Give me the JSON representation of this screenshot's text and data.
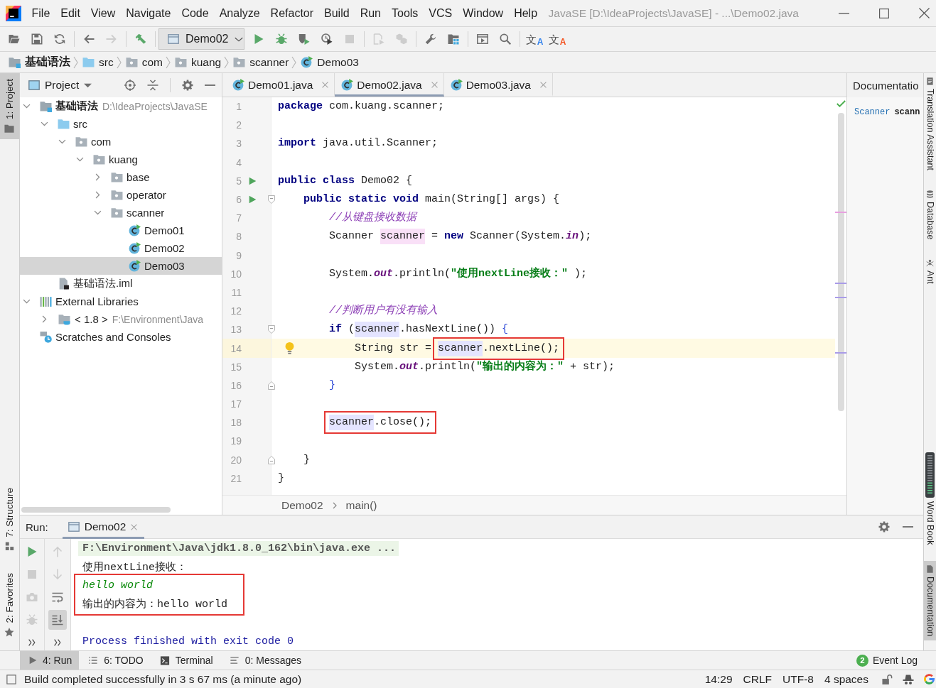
{
  "window": {
    "title": "JavaSE [D:\\IdeaProjects\\JavaSE] - ...\\Demo02.java"
  },
  "menu": [
    "File",
    "Edit",
    "View",
    "Navigate",
    "Code",
    "Analyze",
    "Refactor",
    "Build",
    "Run",
    "Tools",
    "VCS",
    "Window",
    "Help"
  ],
  "toolbar": {
    "groups": [
      [
        {
          "kind": "open",
          "disabled": false
        },
        {
          "kind": "save",
          "disabled": false
        },
        {
          "kind": "sync",
          "disabled": false
        }
      ],
      [
        {
          "kind": "back",
          "disabled": false
        },
        {
          "kind": "forward",
          "disabled": true
        }
      ],
      [
        {
          "kind": "build",
          "disabled": false
        }
      ],
      [
        {
          "kind": "run_config",
          "label": "Demo02",
          "disabled": false
        },
        {
          "kind": "run",
          "disabled": false
        },
        {
          "kind": "debug",
          "disabled": false
        },
        {
          "kind": "coverage",
          "disabled": false
        },
        {
          "kind": "profile",
          "disabled": false
        },
        {
          "kind": "stop",
          "disabled": true
        }
      ],
      [
        {
          "kind": "attach",
          "disabled": true
        },
        {
          "kind": "packages",
          "disabled": true
        }
      ],
      [
        {
          "kind": "settings",
          "disabled": false
        },
        {
          "kind": "structure",
          "disabled": false
        }
      ],
      [
        {
          "kind": "frame",
          "disabled": false
        },
        {
          "kind": "search",
          "disabled": false
        }
      ],
      [
        {
          "kind": "translate",
          "glyph": "文",
          "letter": "A",
          "color": "#2f80ed",
          "disabled": false
        },
        {
          "kind": "translate",
          "glyph": "文",
          "letter": "A",
          "color": "#f4511e",
          "disabled": false
        }
      ]
    ]
  },
  "navigation_bar": [
    {
      "kind": "module",
      "label": "基础语法"
    },
    {
      "kind": "source",
      "label": "src"
    },
    {
      "kind": "package",
      "label": "com"
    },
    {
      "kind": "package",
      "label": "kuang"
    },
    {
      "kind": "package",
      "label": "scanner"
    },
    {
      "kind": "class",
      "label": "Demo03"
    }
  ],
  "left_stripe": {
    "top": [
      {
        "kind": "project",
        "label": "1: Project",
        "selected": true
      }
    ],
    "bottom": [
      {
        "kind": "structure",
        "label": "7: Structure",
        "selected": false
      },
      {
        "kind": "favorites",
        "label": "2: Favorites",
        "selected": false
      }
    ]
  },
  "project": {
    "title": "Project",
    "tree": [
      {
        "kind": "module",
        "label": "基础语法",
        "hint": "D:\\IdeaProjects\\JavaSE",
        "expanded": true,
        "selected": false,
        "children": [
          {
            "kind": "source",
            "label": "src",
            "expanded": true,
            "selected": false,
            "children": [
              {
                "kind": "package",
                "label": "com",
                "expanded": true,
                "selected": false,
                "children": [
                  {
                    "kind": "package",
                    "label": "kuang",
                    "expanded": true,
                    "selected": false,
                    "children": [
                      {
                        "kind": "package",
                        "label": "base",
                        "expanded": false,
                        "selected": false
                      },
                      {
                        "kind": "package",
                        "label": "operator",
                        "expanded": false,
                        "selected": false
                      },
                      {
                        "kind": "package",
                        "label": "scanner",
                        "expanded": true,
                        "selected": false,
                        "children": [
                          {
                            "kind": "class",
                            "label": "Demo01",
                            "selected": false
                          },
                          {
                            "kind": "class",
                            "label": "Demo02",
                            "selected": false
                          },
                          {
                            "kind": "class",
                            "label": "Demo03",
                            "selected": true
                          }
                        ]
                      }
                    ]
                  }
                ]
              }
            ]
          },
          {
            "kind": "file",
            "label": "基础语法.iml",
            "selected": false
          }
        ]
      },
      {
        "kind": "libraries",
        "label": "External Libraries",
        "expanded": true,
        "selected": false,
        "children": [
          {
            "kind": "jdk",
            "label": "< 1.8 >",
            "hint": "F:\\Environment\\Java",
            "expanded": false,
            "selected": false
          }
        ]
      },
      {
        "kind": "scratches",
        "label": "Scratches and Consoles",
        "selected": false
      }
    ]
  },
  "editor": {
    "tabs": [
      {
        "label": "Demo01.java",
        "selected": false
      },
      {
        "label": "Demo02.java",
        "selected": true
      },
      {
        "label": "Demo03.java",
        "selected": false
      }
    ],
    "lines": [
      {
        "number": "1",
        "current": false,
        "tokens": [
          {
            "text": "package",
            "kind": "keyword"
          },
          {
            "text": " com.kuang.scanner;",
            "kind": "plain"
          }
        ]
      },
      {
        "number": "2",
        "current": false
      },
      {
        "number": "3",
        "current": false,
        "tokens": [
          {
            "text": "import",
            "kind": "keyword"
          },
          {
            "text": " java.util.Scanner;",
            "kind": "plain"
          }
        ]
      },
      {
        "number": "4",
        "current": false
      },
      {
        "number": "5",
        "current": false,
        "gutter": [
          {
            "kind": "run"
          }
        ],
        "tokens": [
          {
            "text": "public class",
            "kind": "keyword"
          },
          {
            "text": " Demo02 {",
            "kind": "plain"
          }
        ]
      },
      {
        "number": "6",
        "current": false,
        "gutter": [
          {
            "kind": "run"
          },
          {
            "kind": "fold_start"
          }
        ],
        "tokens": [
          {
            "text": "    public static void",
            "kind": "keyword"
          },
          {
            "text": " main(String[] args) {",
            "kind": "plain"
          }
        ]
      },
      {
        "number": "7",
        "current": false,
        "tokens": [
          {
            "text": "        //从键盘接收数据",
            "kind": "comment"
          }
        ]
      },
      {
        "number": "8",
        "current": false,
        "tokens": [
          {
            "text": "        Scanner ",
            "kind": "plain"
          },
          {
            "text": "scanner",
            "kind": "write"
          },
          {
            "text": " = ",
            "kind": "plain"
          },
          {
            "text": "new",
            "kind": "keyword"
          },
          {
            "text": " Scanner(System.",
            "kind": "plain"
          },
          {
            "text": "in",
            "kind": "static"
          },
          {
            "text": ");",
            "kind": "plain"
          }
        ]
      },
      {
        "number": "9",
        "current": false
      },
      {
        "number": "10",
        "current": false,
        "tokens": [
          {
            "text": "        System.",
            "kind": "plain"
          },
          {
            "text": "out",
            "kind": "static"
          },
          {
            "text": ".println(",
            "kind": "plain"
          },
          {
            "text": "\"使用nextLine接收：\"",
            "kind": "string"
          },
          {
            "text": " );",
            "kind": "plain"
          }
        ]
      },
      {
        "number": "11",
        "current": false
      },
      {
        "number": "12",
        "current": false,
        "tokens": [
          {
            "text": "        //判断用户有没有输入",
            "kind": "comment"
          }
        ]
      },
      {
        "number": "13",
        "current": false,
        "gutter": [
          {
            "kind": "fold_start"
          }
        ],
        "tokens": [
          {
            "text": "        if",
            "kind": "keyword"
          },
          {
            "text": " (",
            "kind": "plain"
          },
          {
            "text": "scanner",
            "kind": "read"
          },
          {
            "text": ".hasNextLine()) ",
            "kind": "plain"
          },
          {
            "text": "{",
            "kind": "brace"
          }
        ]
      },
      {
        "number": "14",
        "current": true,
        "gutter": [
          {
            "kind": "bulb"
          }
        ],
        "tokens": [
          {
            "text": "            String str = ",
            "kind": "plain"
          },
          {
            "kind": "boxed",
            "tokens": [
              {
                "text": "scanner",
                "kind": "read"
              },
              {
                "text": ".nextLine();",
                "kind": "plain"
              }
            ]
          }
        ]
      },
      {
        "number": "15",
        "current": false,
        "tokens": [
          {
            "text": "            System.",
            "kind": "plain"
          },
          {
            "text": "out",
            "kind": "static"
          },
          {
            "text": ".println(",
            "kind": "plain"
          },
          {
            "text": "\"输出的内容为：\"",
            "kind": "string"
          },
          {
            "text": " + str);",
            "kind": "plain"
          }
        ]
      },
      {
        "number": "16",
        "current": false,
        "gutter": [
          {
            "kind": "fold_end"
          }
        ],
        "tokens": [
          {
            "text": "        }",
            "kind": "brace"
          }
        ]
      },
      {
        "number": "17",
        "current": false
      },
      {
        "number": "18",
        "current": false,
        "tokens": [
          {
            "kind": "boxed",
            "tokens": [
              {
                "text": "        scanner",
                "kind": "read"
              },
              {
                "text": ".close();",
                "kind": "plain"
              }
            ]
          }
        ]
      },
      {
        "number": "19",
        "current": false
      },
      {
        "number": "20",
        "current": false,
        "gutter": [
          {
            "kind": "fold_end"
          }
        ],
        "tokens": [
          {
            "text": "    }",
            "kind": "plain"
          }
        ]
      },
      {
        "number": "21",
        "current": false,
        "tokens": [
          {
            "text": "}",
            "kind": "plain"
          }
        ]
      }
    ],
    "breadcrumb": [
      "Demo02",
      "main()"
    ]
  },
  "documentation": {
    "title": "Documentatio",
    "link": "Scanner",
    "name": "scann"
  },
  "right_stripe": {
    "top": [
      {
        "kind": "translation",
        "label": "Translation Assistant",
        "selected": false
      },
      {
        "kind": "database",
        "label": "Database",
        "selected": false
      },
      {
        "kind": "ant",
        "label": "Ant",
        "selected": false
      }
    ],
    "bottom": [
      {
        "kind": "wordbook",
        "label": "Word Book",
        "selected": false
      },
      {
        "kind": "documentation",
        "label": "Documentation",
        "selected": true
      }
    ]
  },
  "run": {
    "label": "Run:",
    "tab": {
      "label": "Demo02",
      "selected": true
    },
    "toolbars": [
      [
        {
          "kind": "rerun",
          "disabled": false,
          "on": false
        },
        {
          "kind": "stop",
          "disabled": true,
          "on": false
        },
        {
          "kind": "dump",
          "disabled": true,
          "on": false
        },
        {
          "kind": "exit",
          "disabled": true,
          "on": false
        },
        {
          "kind": "more",
          "disabled": false,
          "on": false
        }
      ],
      [
        {
          "kind": "up",
          "disabled": true,
          "on": false
        },
        {
          "kind": "down",
          "disabled": true,
          "on": false
        },
        {
          "kind": "wrap",
          "disabled": false,
          "on": false
        },
        {
          "kind": "scroll",
          "disabled": false,
          "on": true
        },
        {
          "kind": "more",
          "disabled": false,
          "on": false
        }
      ]
    ],
    "console": [
      {
        "kind": "command",
        "text": "F:\\Environment\\Java\\jdk1.8.0_162\\bin\\java.exe ..."
      },
      {
        "kind": "output",
        "text": "使用nextLine接收："
      },
      {
        "kind": "boxed",
        "lines": [
          {
            "kind": "input",
            "text": "hello world"
          },
          {
            "kind": "output",
            "text": "输出的内容为：hello world"
          }
        ]
      },
      {
        "kind": "blank"
      },
      {
        "kind": "system",
        "text": "Process finished with exit code 0"
      }
    ]
  },
  "bottom_bar": {
    "tabs": [
      {
        "kind": "run",
        "label": "4: Run",
        "selected": true
      },
      {
        "kind": "todo",
        "label": "6: TODO",
        "selected": false
      },
      {
        "kind": "terminal",
        "label": "Terminal",
        "selected": false
      },
      {
        "kind": "messages",
        "label": "0: Messages",
        "selected": false
      }
    ],
    "event_log": {
      "count": "2",
      "label": "Event Log"
    }
  },
  "status_bar": {
    "message": "Build completed successfully in 3 s 67 ms (a minute ago)",
    "items": [
      "14:29",
      "CRLF",
      "UTF-8",
      "4 spaces"
    ]
  }
}
